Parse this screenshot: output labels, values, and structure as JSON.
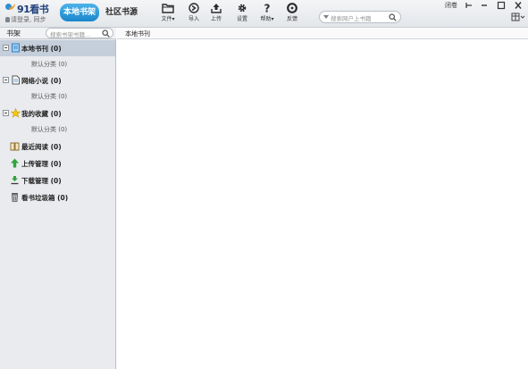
{
  "app": {
    "logo_text": "91看书",
    "login_text": "请登录, 同步"
  },
  "tabs": [
    {
      "label": "本地书架",
      "active": true
    },
    {
      "label": "社区书源",
      "active": false
    }
  ],
  "toolbar": {
    "items": [
      {
        "label": "文件▾",
        "icon": "folder-icon"
      },
      {
        "label": "导入",
        "icon": "import-icon"
      },
      {
        "label": "上传",
        "icon": "upload-icon"
      },
      {
        "label": "设置",
        "icon": "gear-icon"
      },
      {
        "label": "帮助▾",
        "icon": "help-icon"
      },
      {
        "label": "反馈",
        "icon": "feedback-icon"
      }
    ]
  },
  "search": {
    "placeholder": "搜索网户上书籍"
  },
  "window": {
    "user_label": "闭卷",
    "buttons": [
      "pin",
      "minimize",
      "maximize",
      "close"
    ]
  },
  "sidebar": {
    "title": "书架",
    "search_placeholder": "搜索书架书籍...",
    "groups": [
      {
        "label": "本地书刊 (0)",
        "icon": "local-books-icon",
        "expanded": true,
        "selected": true,
        "children": [
          {
            "label": "默认分类 (0)"
          }
        ]
      },
      {
        "label": "网络小说 (0)",
        "icon": "web-novel-icon",
        "expanded": true,
        "selected": false,
        "children": [
          {
            "label": "默认分类 (0)"
          }
        ]
      },
      {
        "label": "我的收藏 (0)",
        "icon": "star-icon",
        "expanded": true,
        "selected": false,
        "children": [
          {
            "label": "默认分类 (0)"
          }
        ]
      },
      {
        "label": "最近阅读 (0)",
        "icon": "open-book-icon",
        "expanded": false,
        "selected": false,
        "children": []
      },
      {
        "label": "上传管理 (0)",
        "icon": "upload-arrow-icon",
        "expanded": false,
        "selected": false,
        "children": []
      },
      {
        "label": "下载管理 (0)",
        "icon": "download-arrow-icon",
        "expanded": false,
        "selected": false,
        "children": []
      },
      {
        "label": "看书垃圾箱 (0)",
        "icon": "trash-icon",
        "expanded": false,
        "selected": false,
        "children": []
      }
    ]
  },
  "main": {
    "title": "本地书刊"
  },
  "colors": {
    "accent": "#1a86cc",
    "selected_row": "#c4cfdb",
    "sidebar_bg": "#e9ebee"
  }
}
